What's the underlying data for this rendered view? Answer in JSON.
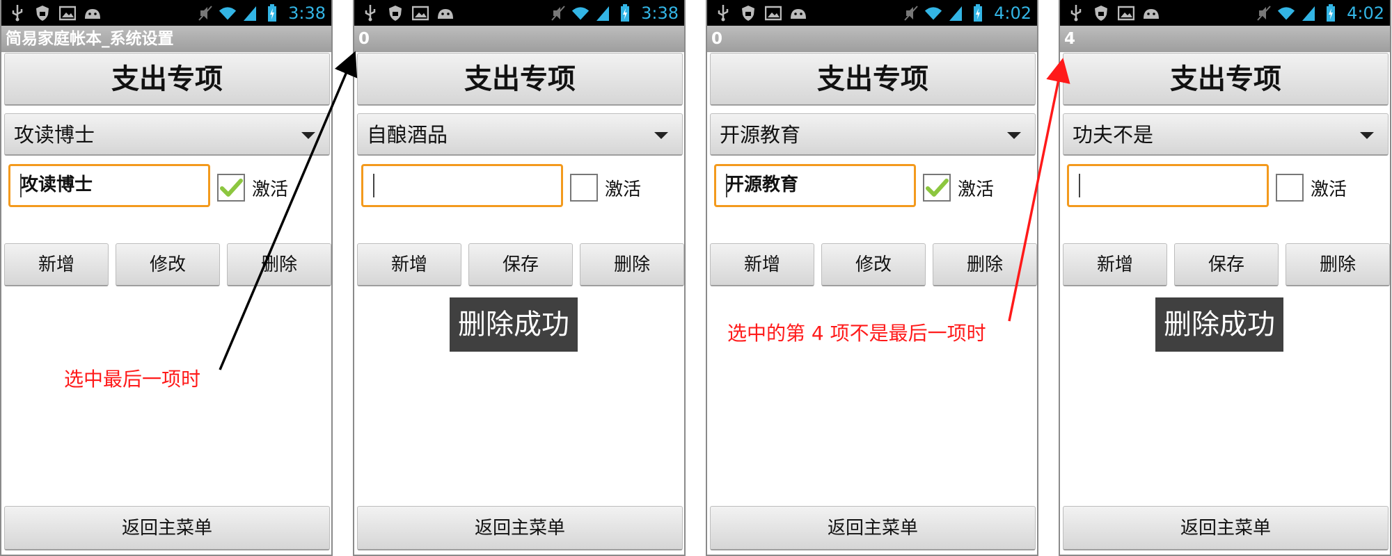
{
  "colors": {
    "accent_time": "#33b5e5",
    "annotation": "#ff1a1a",
    "focus_border": "#f39a1d"
  },
  "screens": [
    {
      "status_time": "3:38",
      "title_bar": "简易家庭帐本_系统设置",
      "header_button": "支出专项",
      "spinner_value": "攻读博士",
      "text_value": "攻读博士",
      "checkbox_checked": true,
      "checkbox_label": "激活",
      "buttons": [
        "新增",
        "修改",
        "删除"
      ],
      "back_button": "返回主菜单",
      "annotation": "选中最后一项时"
    },
    {
      "status_time": "3:38",
      "title_bar": "0",
      "header_button": "支出专项",
      "spinner_value": "自酿酒品",
      "text_value": "",
      "checkbox_checked": false,
      "checkbox_label": "激活",
      "buttons": [
        "新增",
        "保存",
        "删除"
      ],
      "back_button": "返回主菜单",
      "toast": "删除成功"
    },
    {
      "status_time": "4:02",
      "title_bar": "0",
      "header_button": "支出专项",
      "spinner_value": "开源教育",
      "text_value": "开源教育",
      "checkbox_checked": true,
      "checkbox_label": "激活",
      "buttons": [
        "新增",
        "修改",
        "删除"
      ],
      "back_button": "返回主菜单",
      "annotation": "选中的第 4 项不是最后一项时"
    },
    {
      "status_time": "4:02",
      "title_bar": "4",
      "header_button": "支出专项",
      "spinner_value": "功夫不是",
      "text_value": "",
      "checkbox_checked": false,
      "checkbox_label": "激活",
      "buttons": [
        "新增",
        "保存",
        "删除"
      ],
      "back_button": "返回主菜单",
      "toast": "删除成功"
    }
  ]
}
